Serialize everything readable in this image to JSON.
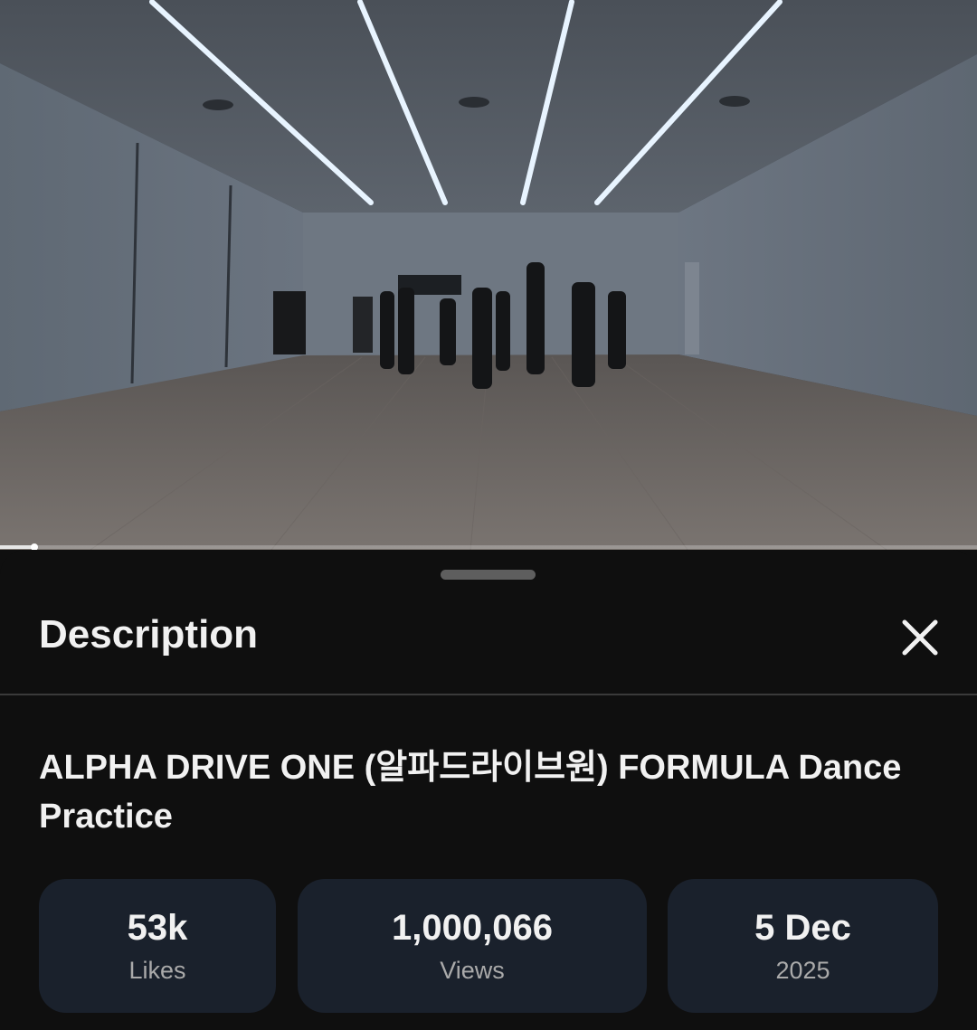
{
  "player": {
    "progress_fraction": 0.035
  },
  "panel": {
    "title": "Description",
    "close_icon": "close-icon"
  },
  "video": {
    "title": "ALPHA DRIVE ONE (알파드라이브원) FORMULA Dance Practice"
  },
  "stats": [
    {
      "value": "53k",
      "label": "Likes"
    },
    {
      "value": "1,000,066",
      "label": "Views"
    },
    {
      "value": "5 Dec",
      "label": "2025"
    }
  ],
  "colors": {
    "sheet_background": "#0f0f0f",
    "stat_background": "#1a212c",
    "primary_text": "#f1f1f1",
    "secondary_text": "#aaaaaa"
  }
}
